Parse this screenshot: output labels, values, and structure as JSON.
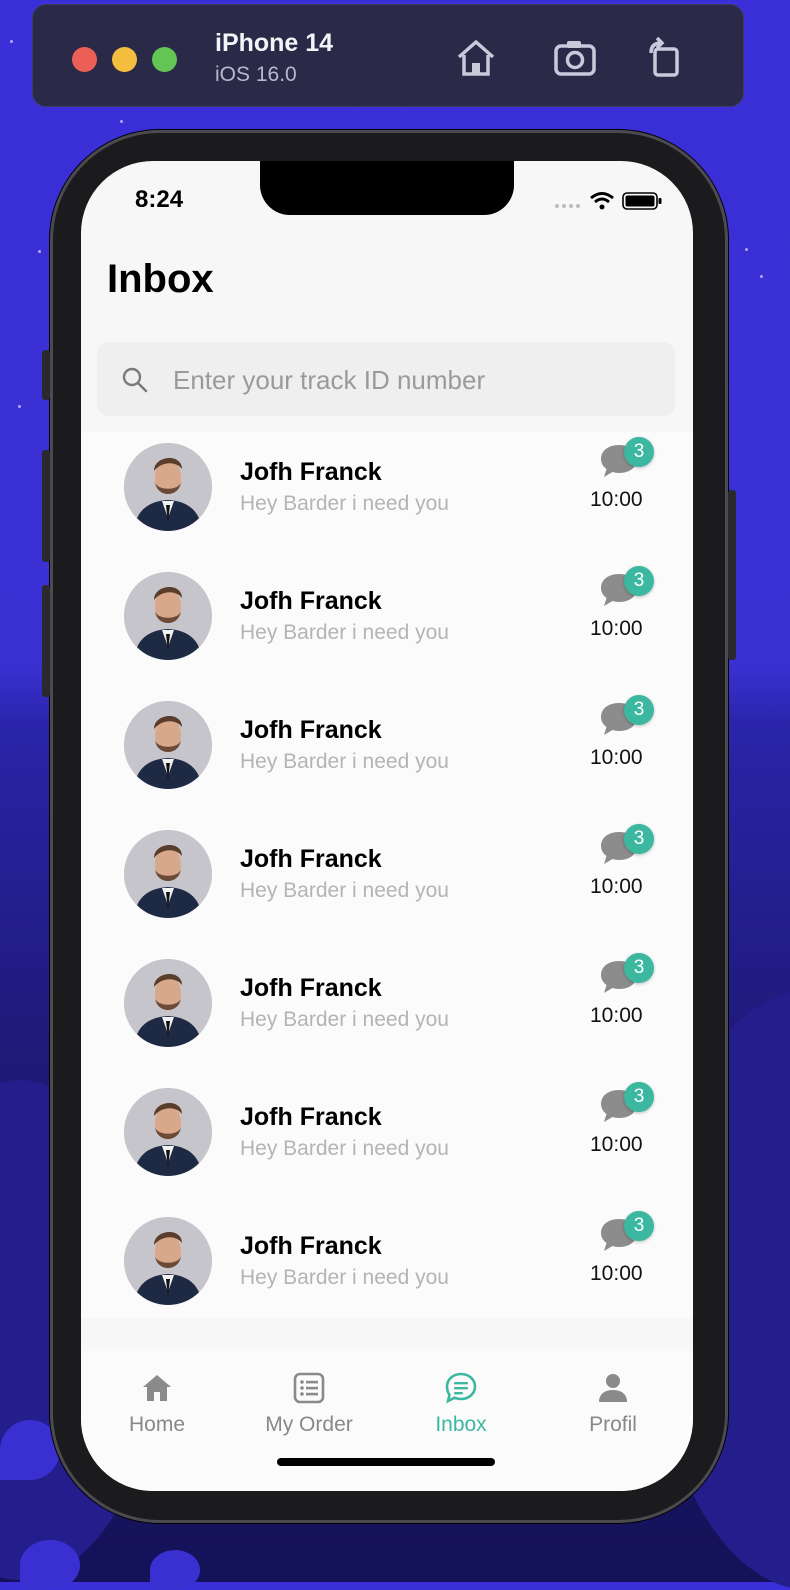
{
  "simulator": {
    "device_name": "iPhone 14",
    "os_version": "iOS 16.0",
    "traffic_colors": [
      "#ec5f57",
      "#f5be3f",
      "#62c554"
    ]
  },
  "status_bar": {
    "time": "8:24"
  },
  "page": {
    "title": "Inbox"
  },
  "search": {
    "placeholder": "Enter your track ID number",
    "value": ""
  },
  "conversations": [
    {
      "name": "Jofh Franck",
      "message": "Hey Barder i need you",
      "time": "10:00",
      "unread": "3"
    },
    {
      "name": "Jofh Franck",
      "message": "Hey Barder i need you",
      "time": "10:00",
      "unread": "3"
    },
    {
      "name": "Jofh Franck",
      "message": "Hey Barder i need you",
      "time": "10:00",
      "unread": "3"
    },
    {
      "name": "Jofh Franck",
      "message": "Hey Barder i need you",
      "time": "10:00",
      "unread": "3"
    },
    {
      "name": "Jofh Franck",
      "message": "Hey Barder i need you",
      "time": "10:00",
      "unread": "3"
    },
    {
      "name": "Jofh Franck",
      "message": "Hey Barder i need you",
      "time": "10:00",
      "unread": "3"
    },
    {
      "name": "Jofh Franck",
      "message": "Hey Barder i need you",
      "time": "10:00",
      "unread": "3"
    }
  ],
  "tabs": [
    {
      "label": "Home",
      "icon": "home-icon"
    },
    {
      "label": "My Order",
      "icon": "list-icon"
    },
    {
      "label": "Inbox",
      "icon": "chat-icon",
      "active": true
    },
    {
      "label": "Profil",
      "icon": "person-icon"
    }
  ],
  "colors": {
    "accent": "#3db8a0",
    "badge": "#3db8a0",
    "muted_text": "#b4b4b4"
  }
}
